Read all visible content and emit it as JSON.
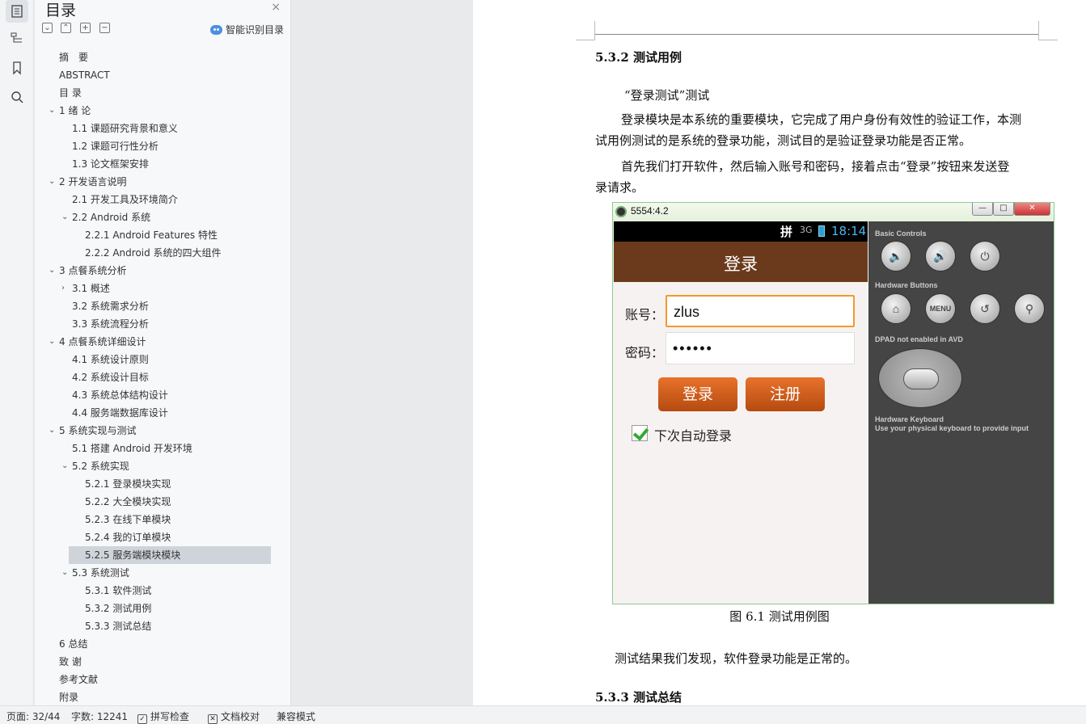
{
  "toc_panel": {
    "title": "目录",
    "close": "×",
    "smart_toc_label": "智能识别目录",
    "items": [
      {
        "text": "摘　要",
        "level": 0,
        "caret": ""
      },
      {
        "text": "ABSTRACT",
        "level": 0,
        "caret": ""
      },
      {
        "text": "目 录",
        "level": 0,
        "caret": ""
      },
      {
        "text": "1 绪 论",
        "level": 0,
        "caret": "⌄"
      },
      {
        "text": "1.1 课题研究背景和意义",
        "level": 1,
        "caret": ""
      },
      {
        "text": "1.2 课题可行性分析",
        "level": 1,
        "caret": ""
      },
      {
        "text": "1.3 论文框架安排",
        "level": 1,
        "caret": ""
      },
      {
        "text": "2 开发语言说明",
        "level": 0,
        "caret": "⌄"
      },
      {
        "text": "2.1 开发工具及环境简介",
        "level": 1,
        "caret": ""
      },
      {
        "text": "2.2 Android 系统",
        "level": 1,
        "caret": "⌄"
      },
      {
        "text": "2.2.1 Android Features 特性",
        "level": 2,
        "caret": ""
      },
      {
        "text": "2.2.2 Android 系统的四大组件",
        "level": 2,
        "caret": ""
      },
      {
        "text": "3 点餐系统分析",
        "level": 0,
        "caret": "⌄"
      },
      {
        "text": "3.1 概述",
        "level": 1,
        "caret": "›"
      },
      {
        "text": "3.2 系统需求分析",
        "level": 1,
        "caret": ""
      },
      {
        "text": "3.3 系统流程分析",
        "level": 1,
        "caret": ""
      },
      {
        "text": "4 点餐系统详细设计",
        "level": 0,
        "caret": "⌄"
      },
      {
        "text": "4.1 系统设计原则",
        "level": 1,
        "caret": ""
      },
      {
        "text": "4.2 系统设计目标",
        "level": 1,
        "caret": ""
      },
      {
        "text": "4.3 系统总体结构设计",
        "level": 1,
        "caret": ""
      },
      {
        "text": "4.4 服务端数据库设计",
        "level": 1,
        "caret": ""
      },
      {
        "text": "5 系统实现与测试",
        "level": 0,
        "caret": "⌄"
      },
      {
        "text": "5.1 搭建 Android 开发环境",
        "level": 1,
        "caret": ""
      },
      {
        "text": "5.2 系统实现",
        "level": 1,
        "caret": "⌄"
      },
      {
        "text": "5.2.1 登录模块实现",
        "level": 2,
        "caret": ""
      },
      {
        "text": "5.2.2 大全模块实现",
        "level": 2,
        "caret": ""
      },
      {
        "text": "5.2.3 在线下单模块",
        "level": 2,
        "caret": ""
      },
      {
        "text": "5.2.4 我的订单模块",
        "level": 2,
        "caret": ""
      },
      {
        "text": "5.2.5 服务端模块模块",
        "level": 2,
        "caret": "",
        "selected": true
      },
      {
        "text": "5.3 系统测试",
        "level": 1,
        "caret": "⌄"
      },
      {
        "text": "5.3.1 软件测试",
        "level": 2,
        "caret": ""
      },
      {
        "text": "5.3.2 测试用例",
        "level": 2,
        "caret": ""
      },
      {
        "text": "5.3.3 测试总结",
        "level": 2,
        "caret": ""
      },
      {
        "text": "6 总结",
        "level": 0,
        "caret": ""
      },
      {
        "text": "致 谢",
        "level": 0,
        "caret": ""
      },
      {
        "text": "参考文献",
        "level": 0,
        "caret": ""
      },
      {
        "text": "附录",
        "level": 0,
        "caret": ""
      }
    ]
  },
  "document": {
    "heading_532": "5.3.2 测试用例",
    "subtitle": "“登录测试”测试",
    "para1_line1": "登录模块是本系统的重要模块，它完成了用户身份有效性的验证工作，本测",
    "para1_line2": "试用例测试的是系统的登录功能，测试目的是验证登录功能是否正常。",
    "para2_line1": "首先我们打开软件，然后输入账号和密码，接着点击“登录”按钮来发送登",
    "para2_line2": "录请求。",
    "figure_caption": "图 6.1 测试用例图",
    "result_text": "测试结果我们发现，软件登录功能是正常的。",
    "heading_533": "5.3.3 测试总结"
  },
  "emulator": {
    "window_title": "5554:4.2",
    "status_ime": "拼",
    "status_signal": "3G",
    "status_time": "18:14",
    "app_title": "登录",
    "account_label": "账号：",
    "account_value": "zlus",
    "password_label": "密码：",
    "password_value": "••••••",
    "login_button": "登录",
    "register_button": "注册",
    "auto_login_label": "下次自动登录",
    "basic_controls_label": "Basic Controls",
    "hardware_buttons_label": "Hardware Buttons",
    "menu_button": "MENU",
    "dpad_label": "DPAD not enabled in AVD",
    "keyboard_label_1": "Hardware Keyboard",
    "keyboard_label_2": "Use your physical keyboard to provide input"
  },
  "statusbar": {
    "page": "页面: 32/44",
    "words": "字数: 12241",
    "spell_check": "拼写检查",
    "doc_proof": "文档校对",
    "compat_mode": "兼容模式"
  },
  "colors": {
    "app_bar": "#6b3a1c",
    "orange_button": "#d2601c",
    "input_focus": "#f2992e",
    "selected_toc": "#cfd4da"
  }
}
